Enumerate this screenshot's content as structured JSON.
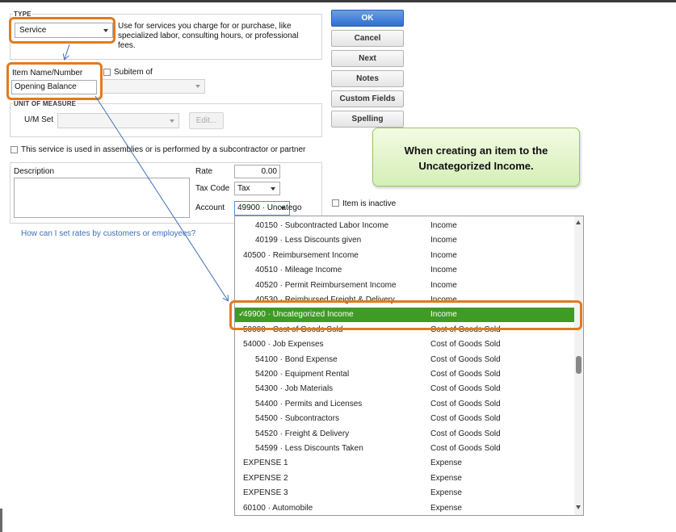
{
  "type_section": {
    "label": "TYPE",
    "selected": "Service",
    "description": "Use for services you charge for or purchase, like specialized labor, consulting hours, or professional fees."
  },
  "item_name": {
    "label": "Item Name/Number",
    "value": "Opening Balance",
    "subitem_label": "Subitem of"
  },
  "unit_of_measure": {
    "label": "UNIT OF MEASURE",
    "um_set_label": "U/M Set",
    "edit_label": "Edit..."
  },
  "assembly_checkbox_label": "This service is used in assemblies or is performed by a subcontractor or partner",
  "description_label": "Description",
  "rate": {
    "label": "Rate",
    "value": "0.00"
  },
  "tax_code": {
    "label": "Tax Code",
    "value": "Tax"
  },
  "account": {
    "label": "Account",
    "value": "49900 · Uncatego"
  },
  "rates_link": "How can I set rates by customers or employees?",
  "buttons": {
    "ok": "OK",
    "cancel": "Cancel",
    "next": "Next",
    "notes": "Notes",
    "custom_fields": "Custom Fields",
    "spelling": "Spelling"
  },
  "inactive_label": "Item is inactive",
  "callout_text": "When creating an item to the Uncategorized Income.",
  "account_list": [
    {
      "name": "40150 · Subcontracted Labor Income",
      "type": "Income",
      "indent": 1
    },
    {
      "name": "40199 · Less Discounts given",
      "type": "Income",
      "indent": 1
    },
    {
      "name": "40500 · Reimbursement Income",
      "type": "Income",
      "indent": 0
    },
    {
      "name": "40510 · Mileage Income",
      "type": "Income",
      "indent": 1
    },
    {
      "name": "40520 · Permit Reimbursement Income",
      "type": "Income",
      "indent": 1
    },
    {
      "name": "40530 · Reimbursed Freight & Delivery",
      "type": "Income",
      "indent": 1
    },
    {
      "name": "49900 · Uncategorized Income",
      "type": "Income",
      "indent": 0,
      "selected": true
    },
    {
      "name": "50000 · Cost of Goods Sold",
      "type": "Cost of Goods Sold",
      "indent": 0
    },
    {
      "name": "54000 · Job Expenses",
      "type": "Cost of Goods Sold",
      "indent": 0
    },
    {
      "name": "54100 · Bond Expense",
      "type": "Cost of Goods Sold",
      "indent": 1
    },
    {
      "name": "54200 · Equipment Rental",
      "type": "Cost of Goods Sold",
      "indent": 1
    },
    {
      "name": "54300 · Job Materials",
      "type": "Cost of Goods Sold",
      "indent": 1
    },
    {
      "name": "54400 · Permits and Licenses",
      "type": "Cost of Goods Sold",
      "indent": 1
    },
    {
      "name": "54500 · Subcontractors",
      "type": "Cost of Goods Sold",
      "indent": 1
    },
    {
      "name": "54520 · Freight & Delivery",
      "type": "Cost of Goods Sold",
      "indent": 1
    },
    {
      "name": "54599 · Less Discounts Taken",
      "type": "Cost of Goods Sold",
      "indent": 1
    },
    {
      "name": "EXPENSE 1",
      "type": "Expense",
      "indent": 0
    },
    {
      "name": "EXPENSE 2",
      "type": "Expense",
      "indent": 0
    },
    {
      "name": "EXPENSE 3",
      "type": "Expense",
      "indent": 0
    },
    {
      "name": "60100 · Automobile",
      "type": "Expense",
      "indent": 0
    }
  ],
  "colors": {
    "highlight": "#e07b20",
    "selected_row": "#3f9a26",
    "primary_button": "#2f6fcf",
    "callout": "#d5efb6",
    "arrow": "#3f6fb5"
  }
}
